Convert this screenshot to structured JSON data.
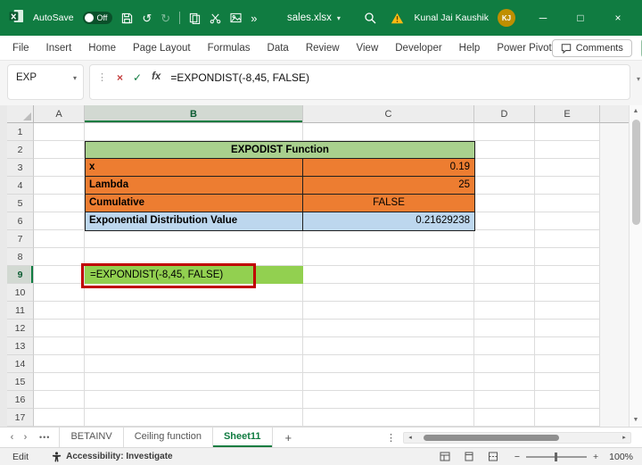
{
  "titlebar": {
    "autosave_label": "AutoSave",
    "autosave_state": "Off",
    "filename": "sales.xlsx",
    "user_name": "Kunal Jai Kaushik",
    "user_initials": "KJ"
  },
  "menu": {
    "tabs": [
      "File",
      "Insert",
      "Home",
      "Page Layout",
      "Formulas",
      "Data",
      "Review",
      "View",
      "Developer",
      "Help",
      "Power Pivot"
    ],
    "comments_label": "Comments"
  },
  "formula_bar": {
    "name_box_value": "EXP",
    "formula": "=EXPONDIST(-8,45, FALSE)"
  },
  "grid": {
    "column_headers": [
      "A",
      "B",
      "C",
      "D",
      "E"
    ],
    "row_headers": [
      "1",
      "2",
      "3",
      "4",
      "5",
      "6",
      "7",
      "8",
      "9",
      "10",
      "11",
      "12",
      "13",
      "14",
      "15",
      "16",
      "17"
    ],
    "active_column": "B",
    "active_row": "9"
  },
  "table": {
    "title": "EXPODIST Function",
    "rows": [
      {
        "label": "x",
        "value": "0.19",
        "bg": "orange",
        "align": "right"
      },
      {
        "label": "Lambda",
        "value": "25",
        "bg": "orange",
        "align": "right"
      },
      {
        "label": "Cumulative",
        "value": "FALSE",
        "bg": "orange",
        "align": "center"
      },
      {
        "label": "Exponential Distribution Value",
        "value": "0.21629238",
        "bg": "blue",
        "align": "right"
      }
    ]
  },
  "cell_b9": {
    "text": "=EXPONDIST(-8,45, FALSE)"
  },
  "sheet_tabs": {
    "tabs": [
      {
        "label": "BETAINV",
        "active": false
      },
      {
        "label": "Ceiling function",
        "active": false
      },
      {
        "label": "Sheet11",
        "active": true
      }
    ]
  },
  "status_bar": {
    "mode": "Edit",
    "accessibility": "Accessibility: Investigate",
    "zoom": "100%"
  },
  "colors": {
    "titlebar_green": "#107C41",
    "table_header_green": "#A9D08E",
    "orange": "#ED7D31",
    "light_blue": "#BDD7EE",
    "b9_green": "#92D050",
    "annotation_red": "#C00000",
    "avatar_gold": "#BF8F00"
  }
}
